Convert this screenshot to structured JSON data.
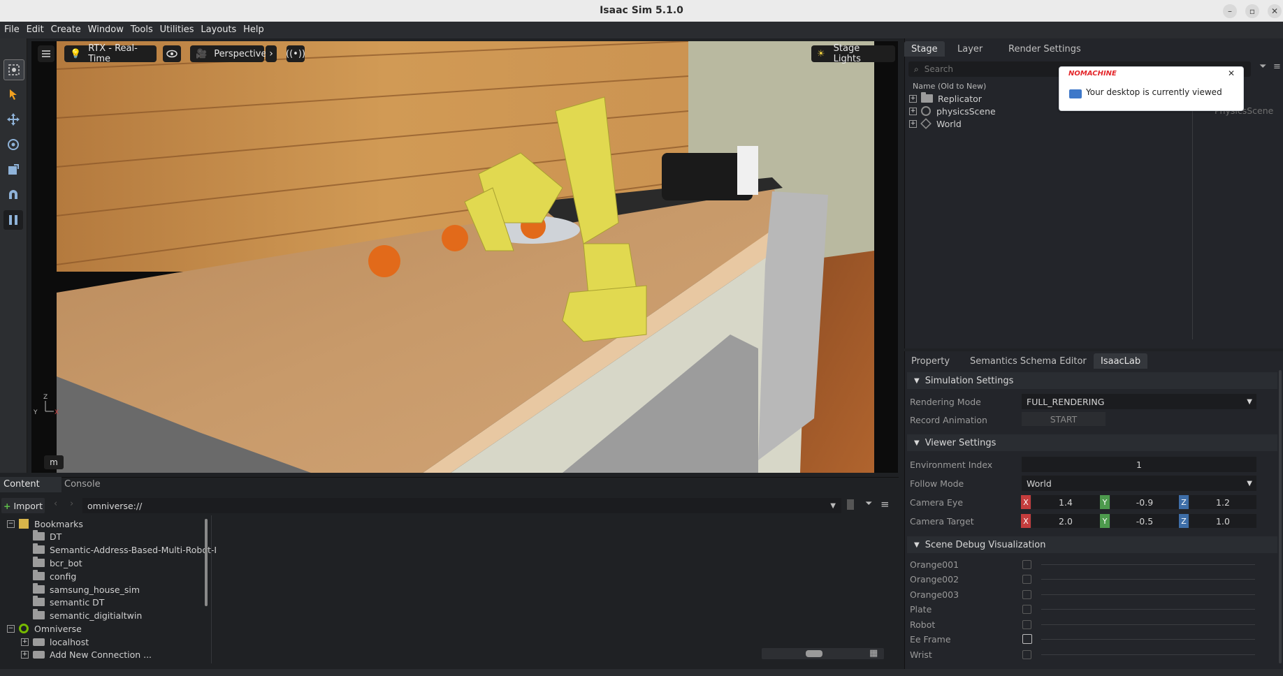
{
  "window": {
    "title": "Isaac Sim 5.1.0",
    "minimize_icon": "minimize-icon",
    "maximize_icon": "maximize-icon",
    "close_icon": "close-icon"
  },
  "menubar": [
    "File",
    "Edit",
    "Create",
    "Window",
    "Tools",
    "Utilities",
    "Layouts",
    "Help"
  ],
  "viewport": {
    "renderer_label": "RTX - Real-Time",
    "camera_label": "Perspective",
    "lights_label": "Stage Lights",
    "unit_label": "m",
    "axis_labels": {
      "z": "Z",
      "y": "Y",
      "x": "X"
    }
  },
  "stage": {
    "tabs": [
      "Stage",
      "Layer",
      "Render Settings"
    ],
    "search_placeholder": "Search",
    "column_header": "Name (Old to New)",
    "items": [
      {
        "name": "Replicator",
        "type_label": ""
      },
      {
        "name": "physicsScene",
        "type_label": "PhysicsScene"
      },
      {
        "name": "World",
        "type_label": ""
      }
    ]
  },
  "notification": {
    "brand": "NOMACHINE",
    "message": "Your desktop is currently viewed"
  },
  "property": {
    "tabs": [
      "Property",
      "Semantics Schema Editor",
      "IsaacLab"
    ],
    "simulation": {
      "header": "Simulation Settings",
      "rendering_mode_label": "Rendering Mode",
      "rendering_mode_value": "FULL_RENDERING",
      "record_animation_label": "Record Animation",
      "record_button": "START"
    },
    "viewer": {
      "header": "Viewer Settings",
      "env_index_label": "Environment Index",
      "env_index_value": "1",
      "follow_mode_label": "Follow Mode",
      "follow_mode_value": "World",
      "camera_eye_label": "Camera Eye",
      "camera_eye": {
        "x": "1.4",
        "y": "-0.9",
        "z": "1.2"
      },
      "camera_target_label": "Camera Target",
      "camera_target": {
        "x": "2.0",
        "y": "-0.5",
        "z": "1.0"
      },
      "axis_letters": {
        "x": "X",
        "y": "Y",
        "z": "Z"
      }
    },
    "debug": {
      "header": "Scene Debug Visualization",
      "items": [
        "Orange001",
        "Orange002",
        "Orange003",
        "Plate",
        "Robot",
        "Ee Frame",
        "Wrist"
      ]
    }
  },
  "content": {
    "tabs": [
      "Content",
      "Console"
    ],
    "import_label": "Import",
    "path_value": "omniverse://",
    "bookmarks_label": "Bookmarks",
    "bookmarks": [
      "DT",
      "Semantic-Address-Based-Multi-Robot-I",
      "bcr_bot",
      "config",
      "samsung_house_sim",
      "semantic DT",
      "semantic_digitialtwin"
    ],
    "omniverse_label": "Omniverse",
    "connections": [
      "localhost",
      "Add New Connection ..."
    ]
  },
  "colors": {
    "accent_blue": "#4b7fc1",
    "axis_x": "#c43d3d",
    "axis_y": "#4d9a4d",
    "axis_z": "#3e6ea8",
    "toast_brand": "#e3262a"
  }
}
